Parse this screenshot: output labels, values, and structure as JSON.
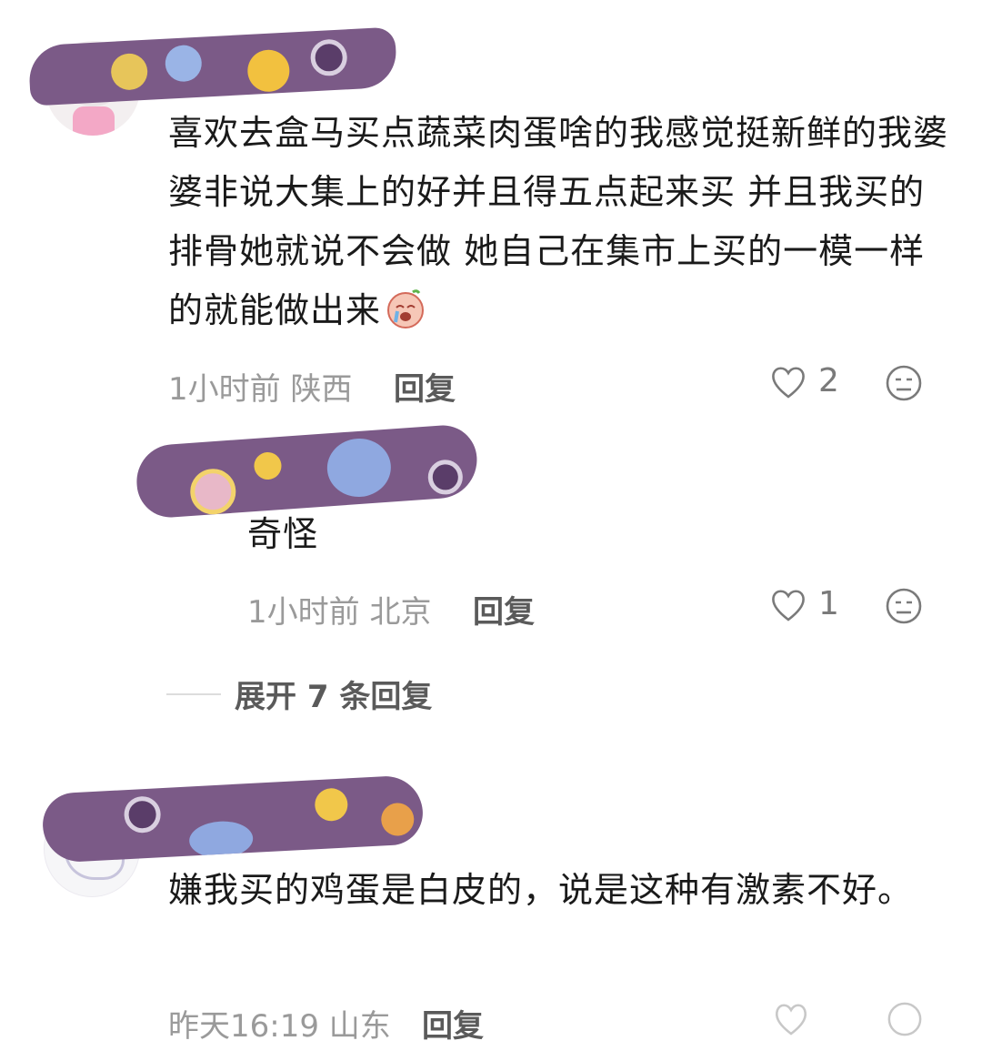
{
  "comments": [
    {
      "text": "喜欢去盒马买点蔬菜肉蛋啥的我感觉挺新鲜的我婆婆非说大集上的好并且得五点起来买 并且我买的排骨她就说不会做 她自己在集市上买的一模一样的就能做出来",
      "emoji": "crying-emoji",
      "time": "1小时前",
      "location": "陕西",
      "reply_label": "回复",
      "likes": "2"
    },
    {
      "text": "嫌我买的鸡蛋是白皮的，说是这种有激素不好。",
      "time": "昨天16:19",
      "location": "山东",
      "reply_label": "回复"
    }
  ],
  "reply": {
    "text": "奇怪",
    "time": "1小时前",
    "location": "北京",
    "reply_label": "回复",
    "likes": "1"
  },
  "expand_label": "展开 7 条回复",
  "colors": {
    "censor": "#7b5a87",
    "text": "#1a1a1a",
    "meta": "#9a9a9a"
  }
}
